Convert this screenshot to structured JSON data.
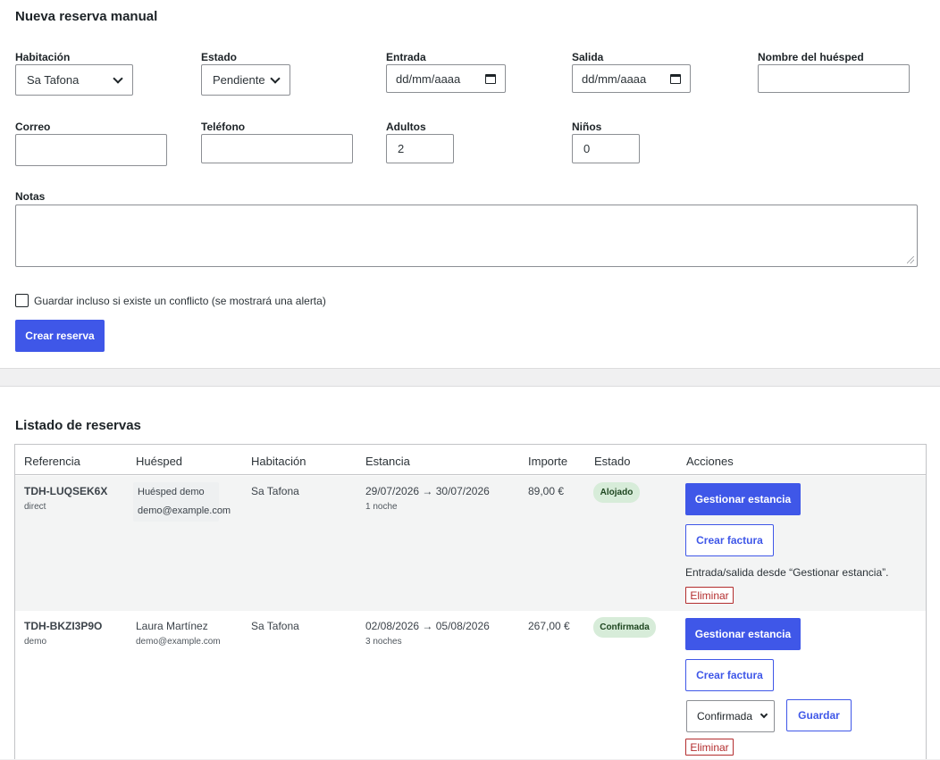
{
  "form": {
    "title": "Nueva reserva manual",
    "room": {
      "label": "Habitación",
      "value": "Sa Tafona"
    },
    "status": {
      "label": "Estado",
      "value": "Pendiente"
    },
    "checkin": {
      "label": "Entrada",
      "placeholder": "dd/mm/aaaa"
    },
    "checkout": {
      "label": "Salida",
      "placeholder": "dd/mm/aaaa"
    },
    "guest_name": {
      "label": "Nombre del huésped",
      "value": ""
    },
    "email": {
      "label": "Correo",
      "value": ""
    },
    "phone": {
      "label": "Teléfono",
      "value": ""
    },
    "adults": {
      "label": "Adultos",
      "value": "2"
    },
    "children": {
      "label": "Niños",
      "value": "0"
    },
    "notes": {
      "label": "Notas",
      "value": ""
    },
    "conflict_checkbox_label": "Guardar incluso si existe un conflicto (se mostrará una alerta)",
    "submit_label": "Crear reserva"
  },
  "list": {
    "title": "Listado de reservas",
    "columns": [
      "Referencia",
      "Huésped",
      "Habitación",
      "Estancia",
      "Importe",
      "Estado",
      "Acciones"
    ],
    "rows": [
      {
        "reference": "TDH-LUQSEK6X",
        "source": "direct",
        "guest_name": "Huésped demo",
        "guest_email": "demo@example.com",
        "room": "Sa Tafona",
        "stay": "29/07/2026 → 30/07/2026",
        "nights": "1 noche",
        "amount": "89,00 €",
        "status": "Alojado",
        "manage_label": "Gestionar estancia",
        "invoice_label": "Crear factura",
        "hint": "Entrada/salida desde “Gestionar estancia”.",
        "delete_label": "Eliminar"
      },
      {
        "reference": "TDH-BKZI3P9O",
        "source": "demo",
        "guest_name": "Laura Martínez",
        "guest_email": "demo@example.com",
        "room": "Sa Tafona",
        "stay": "02/08/2026 → 05/08/2026",
        "nights": "3 noches",
        "amount": "267,00 €",
        "status": "Confirmada",
        "manage_label": "Gestionar estancia",
        "invoice_label": "Crear factura",
        "status_select_value": "Confirmada",
        "save_label": "Guardar",
        "delete_label": "Eliminar"
      }
    ]
  },
  "colors": {
    "primary": "#3f57e8",
    "danger": "#b32d2e",
    "badge_bg": "#d7ecd9",
    "badge_text": "#1e4620"
  }
}
